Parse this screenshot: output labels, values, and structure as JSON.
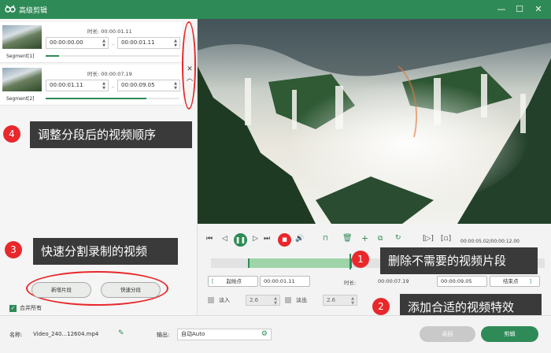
{
  "window": {
    "title": "高级剪辑",
    "minimize": "—",
    "maximize": "☐",
    "close": "✕",
    "accent_color": "#2e8b57"
  },
  "segments": [
    {
      "name": "Segment[1]",
      "duration_label": "时长:",
      "duration": "00:00:01.11",
      "start": "00:00:00.00",
      "end": "00:00:01.11",
      "progress": 0.1
    },
    {
      "name": "Segment[2]",
      "duration_label": "时长:",
      "duration": "00:00:07.19",
      "start": "00:00:01.11",
      "end": "00:00:09.05",
      "progress": 0.75
    }
  ],
  "annotations": {
    "step4": {
      "number": "4",
      "text": "调整分段后的视频顺序"
    },
    "step3": {
      "number": "3",
      "text": "快速分割录制的视频"
    },
    "step1": {
      "number": "1",
      "text": "删除不需要的视频片段"
    },
    "step2": {
      "number": "2",
      "text": "添加合适的视频特效"
    }
  },
  "left_panel": {
    "new_segment": "新增片段",
    "quick_split": "快速分段",
    "merge_all": "合并所有",
    "merge_checked": true
  },
  "player": {
    "time_readout": "00:00:05.02/00:00:12.00",
    "progress": 0.42,
    "trim_start_fraction": 0.11,
    "trim_end_fraction": 0.42
  },
  "trim": {
    "start_label": "起始点",
    "start_value": "00:00:01.11",
    "duration_label": "时长:",
    "duration_value": "00:00:07.19",
    "end_value": "00:00:09.05",
    "end_label": "结束点"
  },
  "effects": {
    "fade_in_label": "淡入",
    "fade_in_value": "2.6",
    "fade_out_label": "淡出",
    "fade_out_value": "2.6"
  },
  "bottom": {
    "name_label": "名称:",
    "file_name": "Video_240...12604.mp4",
    "output_label": "输出:",
    "output_value": "自动Auto",
    "back_button": "返回",
    "cut_button": "剪辑"
  }
}
